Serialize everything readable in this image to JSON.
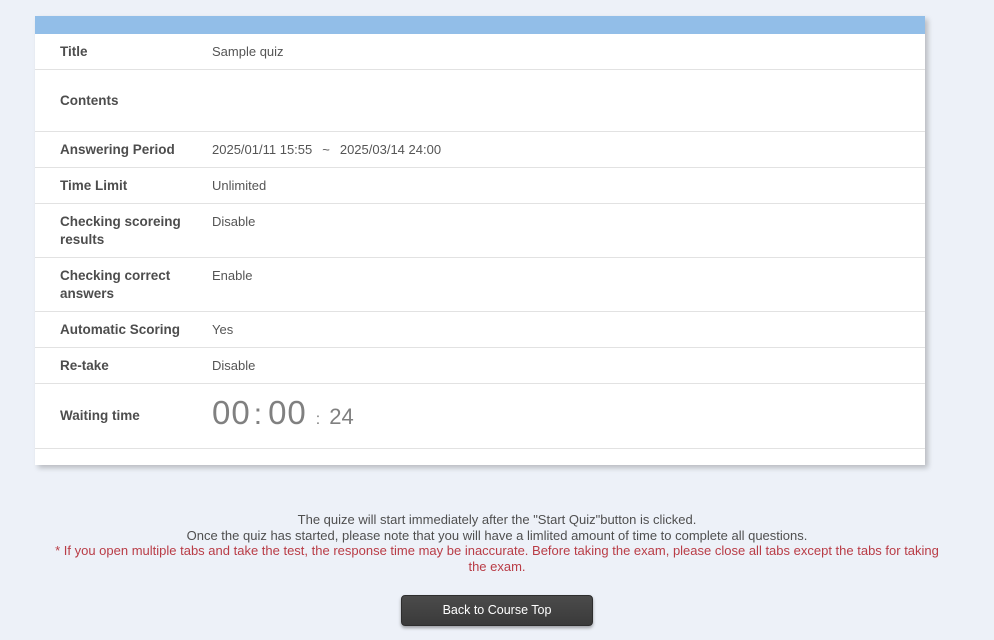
{
  "colors": {
    "page_background": "#edf1f8",
    "header_bar": "#92bee8",
    "warning_text": "#b93c46",
    "button_background": "#3f3f3f"
  },
  "quiz_info": {
    "title": {
      "label": "Title",
      "value": "Sample quiz"
    },
    "contents": {
      "label": "Contents",
      "value": ""
    },
    "answering_period": {
      "label": "Answering Period",
      "start": "2025/01/11 15:55",
      "separator": "~",
      "end": "2025/03/14 24:00"
    },
    "time_limit": {
      "label": "Time Limit",
      "value": "Unlimited"
    },
    "checking_scoring_results": {
      "label": "Checking scoreing results",
      "value": "Disable"
    },
    "checking_correct_answers": {
      "label": "Checking correct answers",
      "value": "Enable"
    },
    "automatic_scoring": {
      "label": "Automatic Scoring",
      "value": "Yes"
    },
    "retake": {
      "label": "Re-take",
      "value": "Disable"
    },
    "waiting_time": {
      "label": "Waiting time",
      "hours": "00",
      "minutes": "00",
      "seconds": "24",
      "separator": ":"
    }
  },
  "notes": {
    "line1": "The quize will start immediately after the \"Start Quiz\"button is clicked.",
    "line2": "Once the quiz has started, please note that you will have a limlited amount of time to complete all questions.",
    "warning": "* If you open multiple tabs and take the test, the response time may be inaccurate. Before taking the exam, please close all tabs except the tabs for taking the exam."
  },
  "actions": {
    "back_to_course_top": "Back to Course Top"
  }
}
